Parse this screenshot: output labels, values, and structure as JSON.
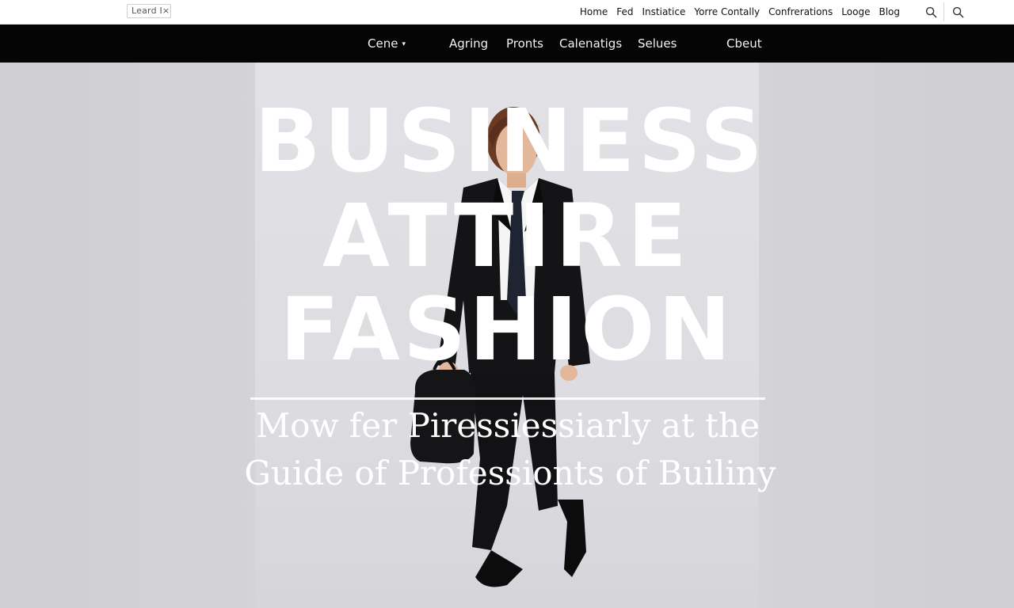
{
  "topbar": {
    "search_text": "Leard I×",
    "links": [
      "Home",
      "Fed",
      "Instiatice",
      "Yorre Contally",
      "Confrerations",
      "Looge",
      "Blog"
    ],
    "icons": [
      "search-icon",
      "search-icon"
    ]
  },
  "mainnav": {
    "items": [
      "Cene",
      "Agring",
      "Pronts",
      "Calenatigs",
      "Selues",
      "Cbeut"
    ],
    "dropdown_caret": "▾"
  },
  "hero": {
    "headline": [
      "BUSINESS",
      "ATTIRE",
      "FASHION"
    ],
    "subheadline": [
      "Mow fer Piressiessiarly at the",
      "Guide of Professionts of Builiny"
    ]
  },
  "colors": {
    "nav_background": "#050505",
    "topbar_background": "#ffffff",
    "hero_background": "#d4d4d8",
    "headline_text": "#ffffff"
  }
}
